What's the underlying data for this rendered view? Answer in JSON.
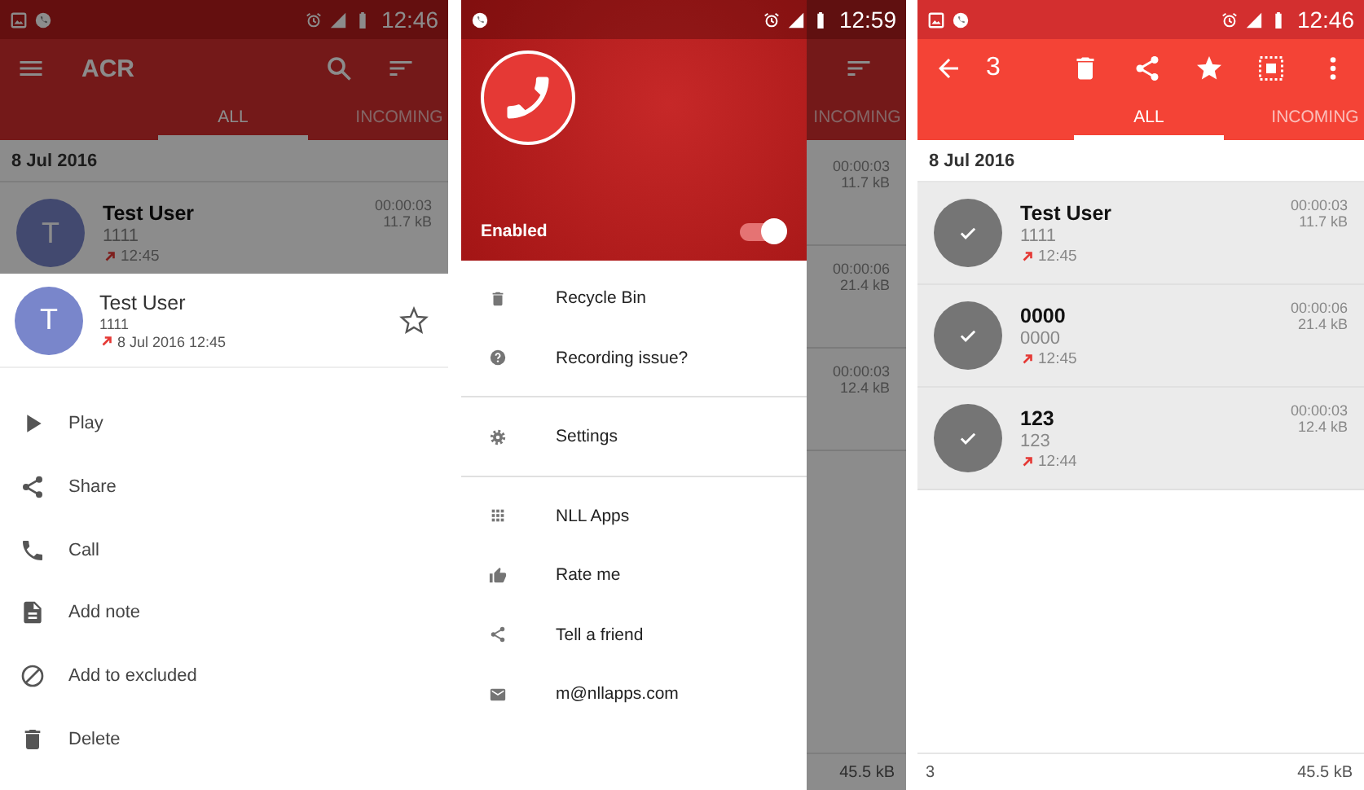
{
  "phones": [
    {
      "kind": "sheet",
      "status_time": "12:46",
      "title": "ACR",
      "tabs": [
        {
          "label": "ALL",
          "selected": true
        },
        {
          "label": "INCOMING",
          "selected": false
        }
      ],
      "date_header": "8 Jul 2016",
      "recordings": [
        {
          "avatar_letter": "T",
          "name": "Test User",
          "number": "1111",
          "time": "12:45",
          "duration": "00:00:03",
          "size": "11.7 kB",
          "selected": false
        }
      ],
      "sheet": {
        "avatar_letter": "T",
        "name": "Test User",
        "number": "1111",
        "datetime": "8 Jul 2016 12:45",
        "starred": false,
        "actions": [
          "Play",
          "Share",
          "Call",
          "Add note",
          "Add to excluded",
          "Delete"
        ]
      }
    },
    {
      "kind": "drawer",
      "status_time": "12:59",
      "tabs": [
        {
          "label": "INCOMING",
          "selected": false
        }
      ],
      "recordings": [
        {
          "duration": "00:00:03",
          "size": "11.7 kB"
        },
        {
          "duration": "00:00:06",
          "size": "21.4 kB"
        },
        {
          "duration": "00:00:03",
          "size": "12.4 kB"
        }
      ],
      "footer": {
        "total_size": "45.5 kB"
      },
      "drawer": {
        "enabled_switch": {
          "label": "Enabled",
          "on": true
        },
        "menu_groups": [
          [
            "Recycle Bin",
            "Recording issue?"
          ],
          [
            "Settings"
          ],
          [
            "NLL Apps",
            "Rate me",
            "Tell a friend",
            "m@nllapps.com"
          ]
        ]
      }
    },
    {
      "kind": "selection",
      "status_time": "12:46",
      "selection_count": "3",
      "tabs": [
        {
          "label": "ALL",
          "selected": true
        },
        {
          "label": "INCOMING",
          "selected": false
        }
      ],
      "date_header": "8 Jul 2016",
      "recordings": [
        {
          "name": "Test User",
          "number": "1111",
          "time": "12:45",
          "duration": "00:00:03",
          "size": "11.7 kB",
          "selected": true
        },
        {
          "name": "0000",
          "number": "0000",
          "time": "12:45",
          "duration": "00:00:06",
          "size": "21.4 kB",
          "selected": true
        },
        {
          "name": "123",
          "number": "123",
          "time": "12:44",
          "duration": "00:00:03",
          "size": "12.4 kB",
          "selected": true
        }
      ],
      "footer": {
        "count": "3",
        "total_size": "45.5 kB"
      }
    }
  ]
}
